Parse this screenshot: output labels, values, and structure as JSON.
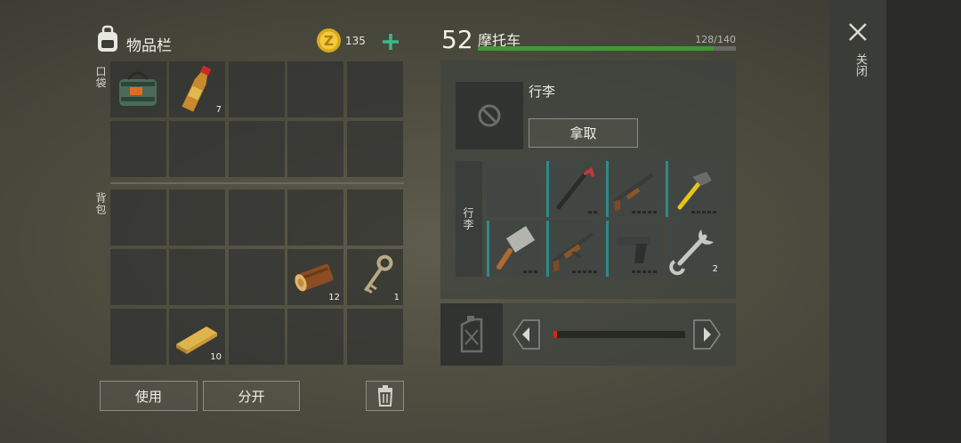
{
  "inventory": {
    "title": "物品栏",
    "coins": "135",
    "pocket_label": "口袋",
    "backpack_label": "背包",
    "items": {
      "bottle_count": "7",
      "log_count": "12",
      "key_count": "1",
      "plank_count": "10"
    },
    "use_button": "使用",
    "split_button": "分开"
  },
  "vehicle": {
    "level": "52",
    "name": "摩托车",
    "durability": "128/140",
    "durability_fraction": 0.914,
    "luggage_title": "行李",
    "take_button": "拿取",
    "storage_label": "行李",
    "wrench_count": "2",
    "fuel_fraction": 0.02
  },
  "close_label": "关闭",
  "colors": {
    "durability": "#3e9a32",
    "accent_plus": "#3bb88a",
    "fuel": "#cc2a1e"
  }
}
